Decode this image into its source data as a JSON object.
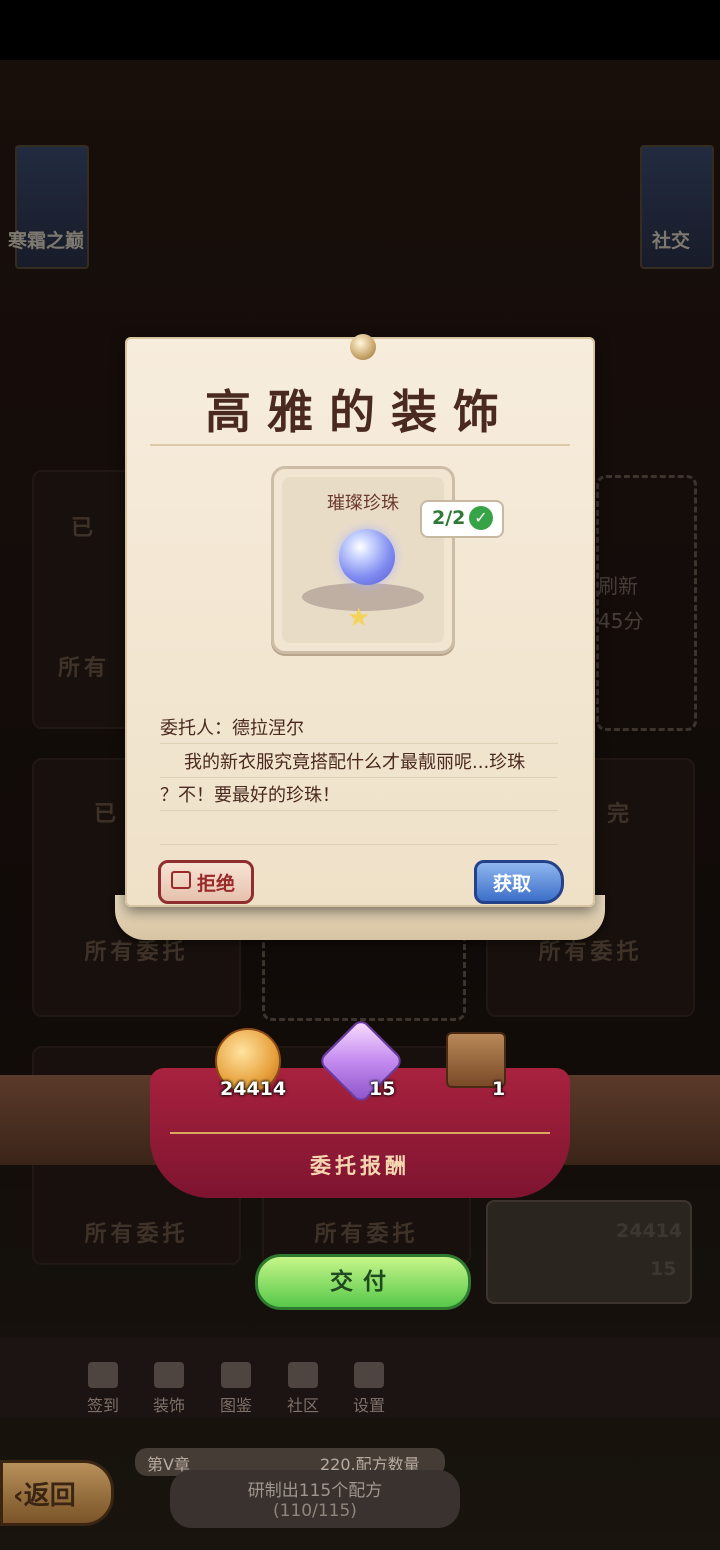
{
  "background": {
    "banner_left": "寒霜之巅",
    "banner_right": "社交",
    "card_labels": {
      "top_left_status": "已",
      "top_left_all": "所有",
      "mid_left_status": "已",
      "mid_left_all": "所有委托",
      "mid_right_status": "完",
      "mid_right_all": "所有委托",
      "bottom_left_all": "所有委托",
      "bottom_mid_all": "所有委托"
    },
    "refresh_label": "刷新",
    "refresh_time": "45分",
    "side_panel_coin": "24414",
    "side_panel_gem": "15"
  },
  "dialog": {
    "title": "高雅的装饰",
    "item": {
      "name": "璀璨珍珠",
      "count": "2/2",
      "icon": "pearl-icon"
    },
    "client": "委托人：德拉涅尔",
    "description_line1": "我的新衣服究竟搭配什么才最靓丽呢...珍珠",
    "description_line2": "？不！要最好的珍珠！",
    "refuse_label": "拒绝",
    "get_label": "获取"
  },
  "reward": {
    "title": "委托报酬",
    "items": [
      {
        "icon": "coin-icon",
        "value": "24414"
      },
      {
        "icon": "gem-icon",
        "value": "15"
      },
      {
        "icon": "rope-icon",
        "value": "1"
      }
    ]
  },
  "submit_label": "交付",
  "nav": [
    {
      "label": "签到",
      "icon": "checkin-icon"
    },
    {
      "label": "装饰",
      "icon": "decoration-icon"
    },
    {
      "label": "图鉴",
      "icon": "book-icon"
    },
    {
      "label": "社区",
      "icon": "community-icon"
    },
    {
      "label": "设置",
      "icon": "gear-icon"
    }
  ],
  "back_label": "返回",
  "chapter": {
    "name": "第V章",
    "recipe_count": "220.配方数量",
    "progress_text": "研制出115个配方",
    "progress_value": "(110/115)"
  },
  "colors": {
    "cloth": "#a8223e",
    "submit_green": "#57c94a",
    "get_blue": "#3c6fc8",
    "refuse_red": "#9a2a2a"
  }
}
